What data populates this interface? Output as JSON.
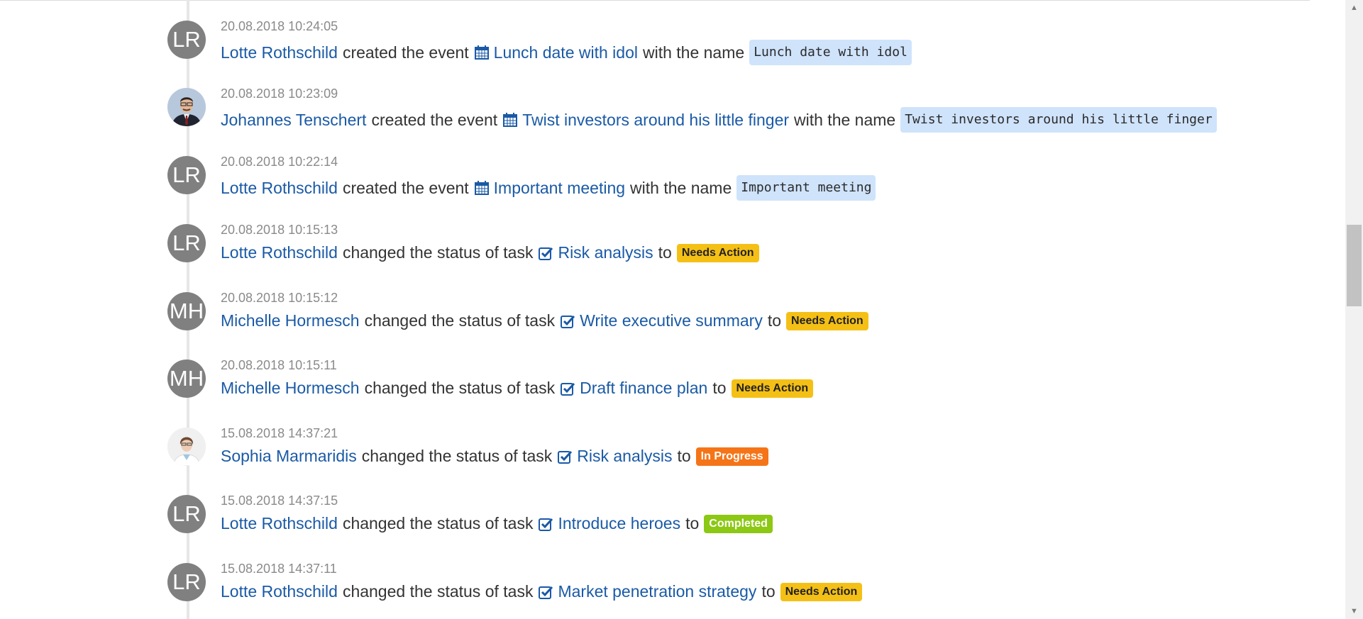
{
  "entries": [
    {
      "timestamp": "20.08.2018 10:24:05",
      "user": "Lotte Rothschild",
      "avatar": {
        "type": "initials",
        "initials": "LR"
      },
      "action": "created the event",
      "object": {
        "icon": "calendar-icon",
        "label": "Lunch date with idol"
      },
      "connector": "with the name",
      "value": {
        "kind": "code",
        "text": "Lunch date with idol"
      }
    },
    {
      "timestamp": "20.08.2018 10:23:09",
      "user": "Johannes Tenschert",
      "avatar": {
        "type": "photo",
        "initials": ""
      },
      "action": "created the event",
      "object": {
        "icon": "calendar-icon",
        "label": "Twist investors around his little finger"
      },
      "connector": "with the name",
      "value": {
        "kind": "code",
        "text": "Twist investors around his little finger"
      }
    },
    {
      "timestamp": "20.08.2018 10:22:14",
      "user": "Lotte Rothschild",
      "avatar": {
        "type": "initials",
        "initials": "LR"
      },
      "action": "created the event",
      "object": {
        "icon": "calendar-icon",
        "label": "Important meeting"
      },
      "connector": "with the name",
      "value": {
        "kind": "code",
        "text": "Important meeting"
      }
    },
    {
      "timestamp": "20.08.2018 10:15:13",
      "user": "Lotte Rothschild",
      "avatar": {
        "type": "initials",
        "initials": "LR"
      },
      "action": "changed the status of task",
      "object": {
        "icon": "checkbox-icon",
        "label": "Risk analysis"
      },
      "connector": "to",
      "value": {
        "kind": "badge",
        "text": "Needs Action",
        "color": "#f5c016"
      }
    },
    {
      "timestamp": "20.08.2018 10:15:12",
      "user": "Michelle Hormesch",
      "avatar": {
        "type": "initials",
        "initials": "MH"
      },
      "action": "changed the status of task",
      "object": {
        "icon": "checkbox-icon",
        "label": "Write executive summary"
      },
      "connector": "to",
      "value": {
        "kind": "badge",
        "text": "Needs Action",
        "color": "#f5c016"
      }
    },
    {
      "timestamp": "20.08.2018 10:15:11",
      "user": "Michelle Hormesch",
      "avatar": {
        "type": "initials",
        "initials": "MH"
      },
      "action": "changed the status of task",
      "object": {
        "icon": "checkbox-icon",
        "label": "Draft finance plan"
      },
      "connector": "to",
      "value": {
        "kind": "badge",
        "text": "Needs Action",
        "color": "#f5c016"
      }
    },
    {
      "timestamp": "15.08.2018 14:37:21",
      "user": "Sophia Marmaridis",
      "avatar": {
        "type": "photo",
        "initials": ""
      },
      "action": "changed the status of task",
      "object": {
        "icon": "checkbox-icon",
        "label": "Risk analysis"
      },
      "connector": "to",
      "value": {
        "kind": "badge",
        "text": "In Progress",
        "color": "#f57418"
      }
    },
    {
      "timestamp": "15.08.2018 14:37:15",
      "user": "Lotte Rothschild",
      "avatar": {
        "type": "initials",
        "initials": "LR"
      },
      "action": "changed the status of task",
      "object": {
        "icon": "checkbox-icon",
        "label": "Introduce heroes"
      },
      "connector": "to",
      "value": {
        "kind": "badge",
        "text": "Completed",
        "color": "#8cc814"
      }
    },
    {
      "timestamp": "15.08.2018 14:37:11",
      "user": "Lotte Rothschild",
      "avatar": {
        "type": "initials",
        "initials": "LR"
      },
      "action": "changed the status of task",
      "object": {
        "icon": "checkbox-icon",
        "label": "Market penetration strategy"
      },
      "connector": "to",
      "value": {
        "kind": "badge",
        "text": "Needs Action",
        "color": "#f5c016"
      }
    }
  ],
  "scrollbar": {
    "up_icon": "arrow-up-icon",
    "down_icon": "arrow-down-icon"
  },
  "colors": {
    "link": "#1a5aa6",
    "code_bg": "#cfe3fb",
    "avatar_bg": "#808080"
  }
}
